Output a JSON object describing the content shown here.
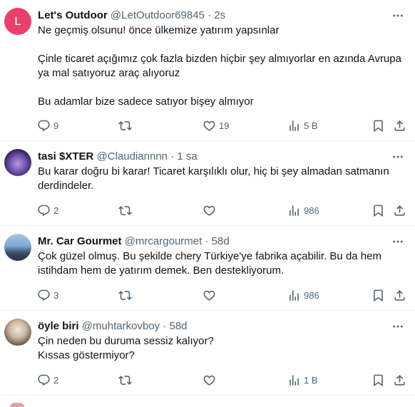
{
  "tweets": [
    {
      "name": "Let's Outdoor",
      "handle": "@LetOutdoor69845",
      "dot": "·",
      "time": "2s",
      "avatar_letter": "L",
      "lines": [
        "Ne geçmiş olsunu! önce ülkemize yatırım yapsınlar",
        "",
        "Çinle ticaret açığımız çok fazla bizden hiçbir şey almıyorlar en azında Avrupa ya mal satıyoruz araç alıyoruz",
        "",
        "Bu adamlar bize sadece satıyor bişey almıyor"
      ],
      "replies": "9",
      "retweets": "",
      "likes": "19",
      "views": "5 B"
    },
    {
      "name": "tasi $XTER",
      "handle": "@Claudiannnn",
      "dot": "·",
      "time": "1 sa",
      "lines": [
        "Bu karar doğru bi karar!  Ticaret karşılıklı olur, hiç bi şey almadan satmanın derdindeler."
      ],
      "replies": "2",
      "retweets": "",
      "likes": "",
      "views": "986"
    },
    {
      "name": "Mr. Car Gourmet",
      "handle": "@mrcargourmet",
      "dot": "·",
      "time": "58d",
      "lines": [
        "Çok güzel olmuş. Bu şekilde chery Türkiye'ye fabrika açabilir. Bu da hem istihdam hem de yatırım demek. Ben destekliyorum."
      ],
      "replies": "3",
      "retweets": "",
      "likes": "",
      "views": "986"
    },
    {
      "name": "öyle biri",
      "handle": "@muhtarkovboy",
      "dot": "·",
      "time": "58d",
      "lines": [
        "Çin neden bu duruma sessiz kalıyor?",
        "Kıssas göstermiyor?"
      ],
      "replies": "2",
      "retweets": "",
      "likes": "",
      "views": "1 B"
    }
  ],
  "icons": {
    "more": "more-horizontal-icon",
    "reply": "reply-icon",
    "retweet": "retweet-icon",
    "like": "heart-icon",
    "views": "views-chart-icon",
    "bookmark": "bookmark-icon",
    "share": "share-icon"
  },
  "colors": {
    "text": "#0f1419",
    "secondary": "#536471",
    "divider": "#eff3f4",
    "avatar_l": "#e8406a"
  }
}
